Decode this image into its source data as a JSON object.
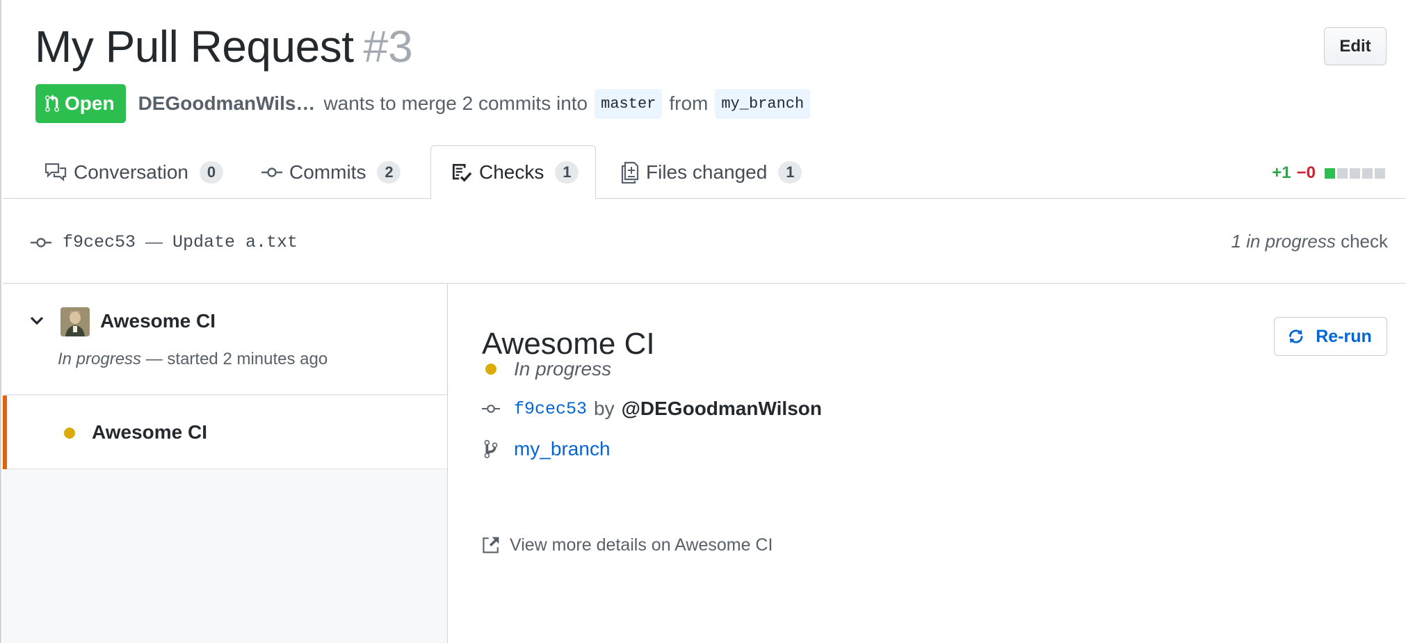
{
  "header": {
    "title": "My Pull Request",
    "number": "#3",
    "edit_label": "Edit"
  },
  "meta": {
    "state": "Open",
    "author": "DEGoodmanWils…",
    "text_merge": "wants to merge 2 commits into",
    "base_branch": "master",
    "text_from": "from",
    "head_branch": "my_branch"
  },
  "tabs": [
    {
      "label": "Conversation",
      "count": "0",
      "icon": "comment-discussion-icon",
      "selected": false
    },
    {
      "label": "Commits",
      "count": "2",
      "icon": "git-commit-icon",
      "selected": false
    },
    {
      "label": "Checks",
      "count": "1",
      "icon": "checklist-icon",
      "selected": true
    },
    {
      "label": "Files changed",
      "count": "1",
      "icon": "diff-icon",
      "selected": false
    }
  ],
  "diffstat": {
    "additions": "+1",
    "deletions": "−0",
    "blocks_green": 1,
    "blocks_total": 5
  },
  "commit": {
    "sha": "f9cec53",
    "separator": "—",
    "message": "Update a.txt",
    "checks_status_em": "1 in progress",
    "checks_status_rest": " check"
  },
  "sidebar": {
    "suite_name": "Awesome CI",
    "suite_status_em": "In progress",
    "suite_status_rest": " — started 2 minutes ago",
    "runs": [
      {
        "name": "Awesome CI",
        "status_color": "#dbab09",
        "active": true
      }
    ]
  },
  "details": {
    "title": "Awesome CI",
    "rerun_label": "Re-run",
    "status": "In progress",
    "commit_sha": "f9cec53",
    "by_text": "by",
    "author": "@DEGoodmanWilson",
    "branch": "my_branch",
    "more_link": "View more details on Awesome CI"
  },
  "colors": {
    "open_green": "#2cbe4e",
    "link_blue": "#0366d6",
    "in_progress_yellow": "#dbab09",
    "active_orange": "#e36209",
    "deletion_red": "#cb2431"
  }
}
